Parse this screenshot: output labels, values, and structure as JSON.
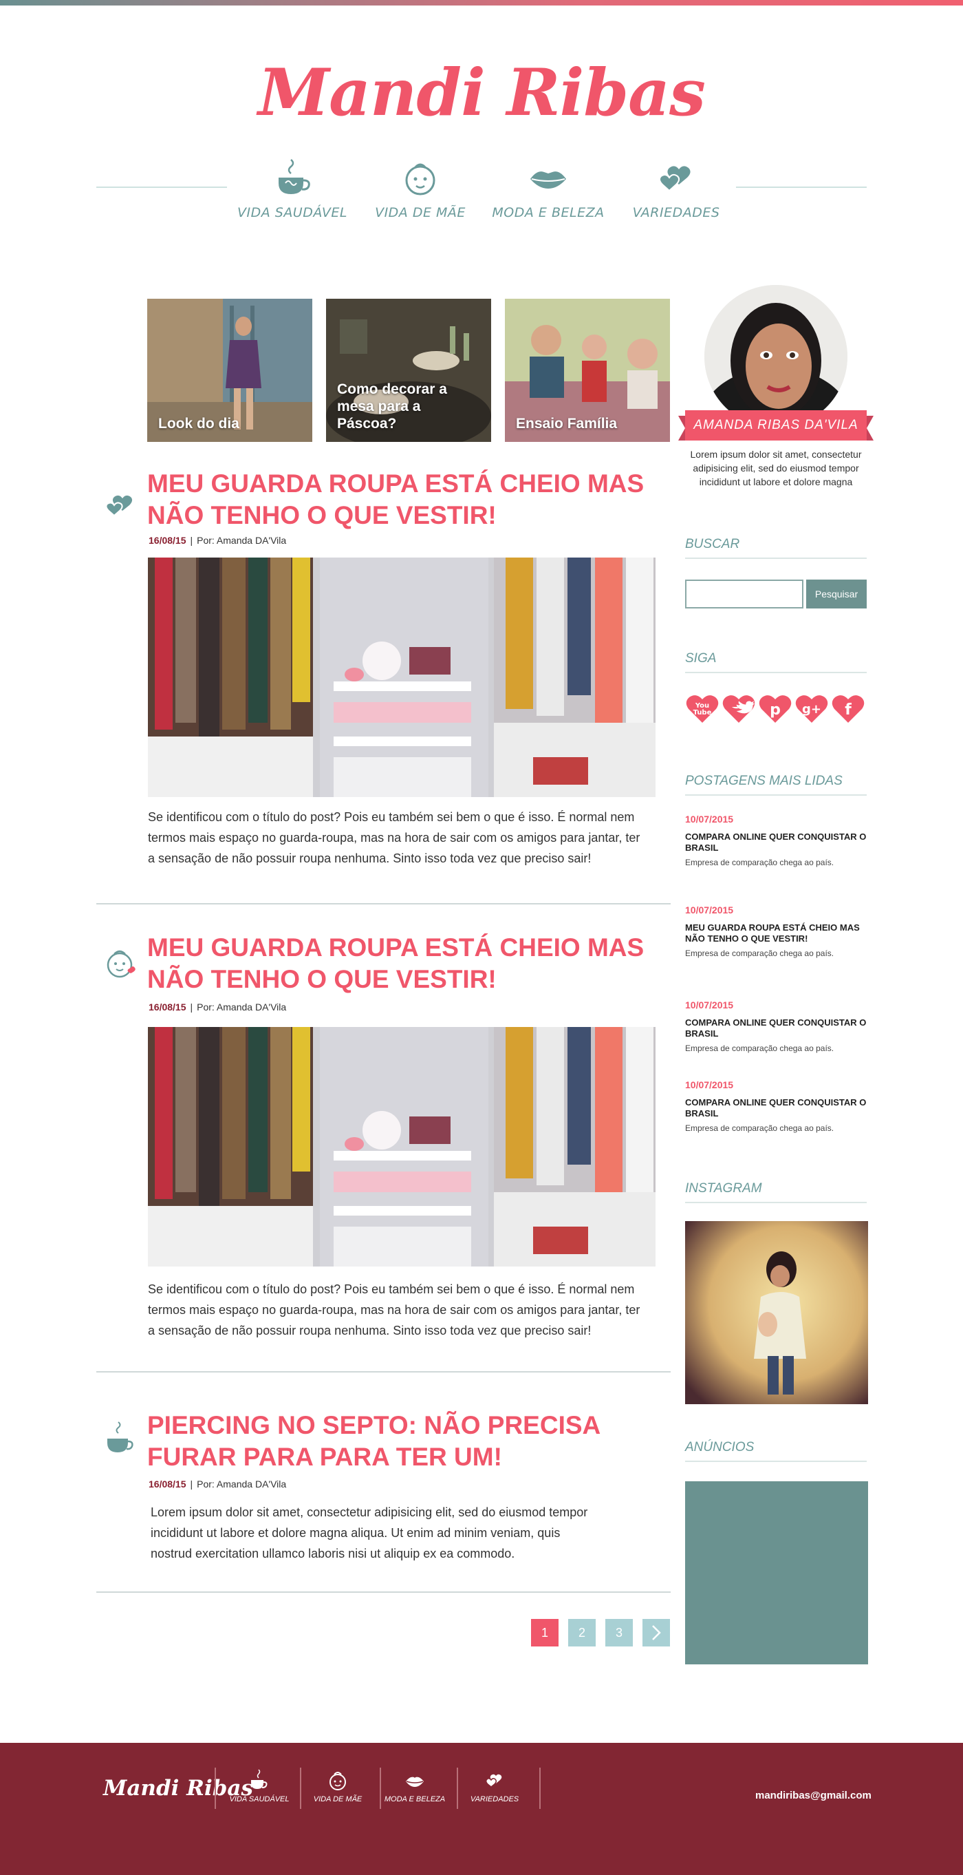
{
  "site": {
    "title": "Mandi Ribas"
  },
  "nav": {
    "items": [
      {
        "label": "VIDA SAUDÁVEL",
        "icon": "teacup-icon"
      },
      {
        "label": "VIDA DE MÃE",
        "icon": "baby-face-icon"
      },
      {
        "label": "MODA E BELEZA",
        "icon": "lips-icon"
      },
      {
        "label": "VARIEDADES",
        "icon": "hearts-icon"
      }
    ]
  },
  "featured": [
    {
      "caption": "Look do dia"
    },
    {
      "caption": "Como decorar a mesa para a Páscoa?"
    },
    {
      "caption": "Ensaio Família"
    }
  ],
  "posts": [
    {
      "icon": "hearts-icon",
      "title": "MEU GUARDA ROUPA ESTÁ CHEIO MAS NÃO TENHO O QUE VESTIR!",
      "date": "16/08/15",
      "author": "Por: Amanda DA'Vila",
      "excerpt": "Se identificou com o título do post? Pois eu também sei bem o que é isso. É normal nem termos mais espaço no guarda-roupa, mas na hora de sair com os amigos para jantar, ter a sensação de não possuir roupa nenhuma. Sinto isso toda vez que preciso sair!"
    },
    {
      "icon": "baby-face-icon",
      "title": "MEU GUARDA ROUPA ESTÁ CHEIO MAS NÃO TENHO O QUE VESTIR!",
      "date": "16/08/15",
      "author": "Por: Amanda DA'Vila",
      "excerpt": "Se identificou com o título do post? Pois eu também sei bem o que é isso. É normal nem termos mais espaço no guarda-roupa, mas na hora de sair com os amigos para jantar, ter a sensação de não possuir roupa nenhuma. Sinto isso toda vez que preciso sair!"
    },
    {
      "icon": "teacup-icon",
      "title": "PIERCING NO SEPTO: NÃO PRECISA FURAR PARA PARA TER UM!",
      "date": "16/08/15",
      "author": "Por: Amanda DA'Vila",
      "excerpt": "Lorem ipsum dolor sit amet, consectetur adipisicing elit, sed do eiusmod tempor incididunt ut labore et dolore magna aliqua. Ut enim ad minim veniam, quis nostrud exercitation ullamco laboris nisi ut aliquip ex ea commodo."
    }
  ],
  "pagination": {
    "pages": [
      "1",
      "2",
      "3"
    ],
    "current": "1",
    "next_icon": "chevron-right-icon"
  },
  "sidebar": {
    "profile": {
      "name": "AMANDA RIBAS DA'VILA",
      "about": "Lorem ipsum dolor sit amet, consectetur adipisicing elit, sed do eiusmod tempor incididunt ut labore et dolore magna"
    },
    "search": {
      "heading": "BUSCAR",
      "button": "Pesquisar",
      "placeholder": ""
    },
    "follow": {
      "heading": "SIGA",
      "networks": [
        {
          "name": "youtube",
          "glyph": "You Tube"
        },
        {
          "name": "twitter",
          "glyph": "t"
        },
        {
          "name": "pinterest",
          "glyph": "p"
        },
        {
          "name": "google-plus",
          "glyph": "g+"
        },
        {
          "name": "facebook",
          "glyph": "f"
        }
      ]
    },
    "popular": {
      "heading": "POSTAGENS MAIS LIDAS",
      "items": [
        {
          "date": "10/07/2015",
          "title": "COMPARA ONLINE QUER CONQUISTAR O BRASIL",
          "summary": "Empresa de comparação chega ao país."
        },
        {
          "date": "10/07/2015",
          "title": "MEU GUARDA ROUPA ESTÁ CHEIO MAS NÃO TENHO O QUE VESTIR!",
          "summary": "Empresa de comparação chega ao país."
        },
        {
          "date": "10/07/2015",
          "title": "COMPARA ONLINE QUER CONQUISTAR O BRASIL",
          "summary": "Empresa de comparação chega ao país."
        },
        {
          "date": "10/07/2015",
          "title": "COMPARA ONLINE QUER CONQUISTAR O BRASIL",
          "summary": "Empresa de comparação chega ao país."
        }
      ]
    },
    "instagram": {
      "heading": "INSTAGRAM"
    },
    "ads": {
      "heading": "ANÚNCIOS"
    }
  },
  "footer": {
    "logo": "Mandi Ribas",
    "items": [
      {
        "label": "VIDA SAUDÁVEL"
      },
      {
        "label": "VIDA DE MÃE"
      },
      {
        "label": "MODA E BELEZA"
      },
      {
        "label": "VARIEDADES"
      }
    ],
    "email": "mandiribas@gmail.com"
  },
  "colors": {
    "accent": "#f0566a",
    "teal": "#6a9a9a",
    "footer": "#822633"
  }
}
